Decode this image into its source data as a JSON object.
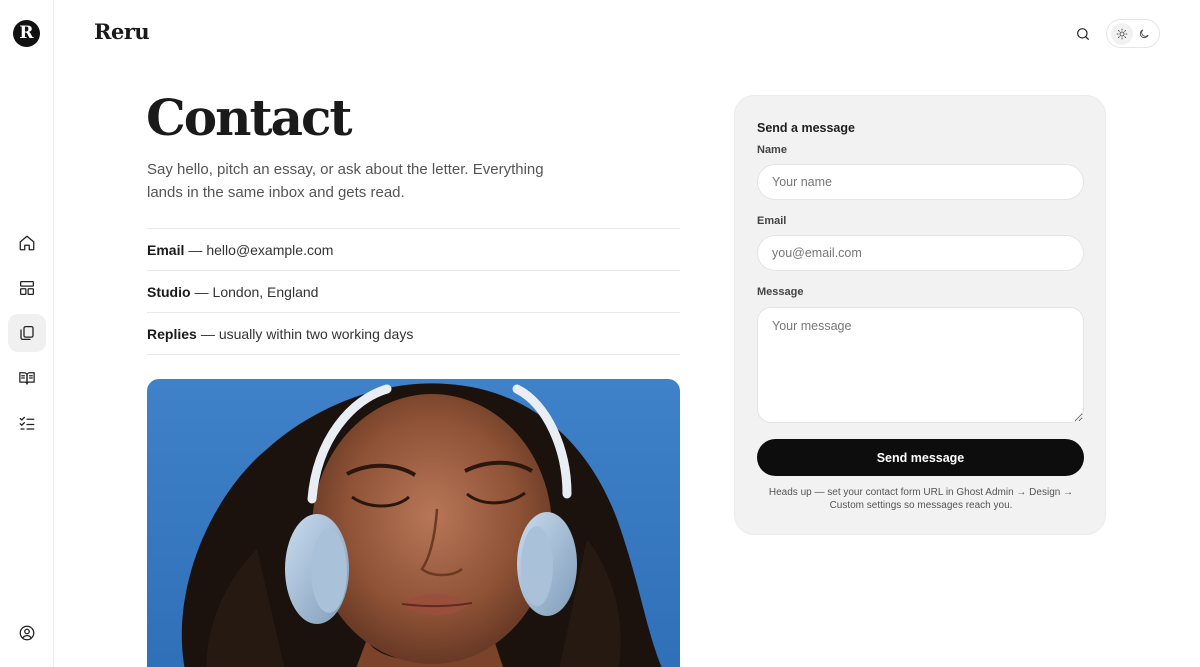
{
  "sidebar": {
    "logo_letter": "R",
    "items": [
      {
        "name": "home",
        "icon": "home-icon"
      },
      {
        "name": "layout",
        "icon": "layout-icon"
      },
      {
        "name": "pages",
        "icon": "copy-icon",
        "active": true
      },
      {
        "name": "library",
        "icon": "book-open-icon"
      },
      {
        "name": "checklist",
        "icon": "list-checks-icon"
      },
      {
        "name": "account",
        "icon": "user-circle-icon"
      }
    ]
  },
  "header": {
    "brand": "Reru",
    "search_icon": "search-icon",
    "theme_toggle": {
      "light_icon": "sun-icon",
      "dark_icon": "moon-icon",
      "selected": "light"
    }
  },
  "main": {
    "title": "Contact",
    "intro": "Say hello, pitch an essay, or ask about the letter. Everything lands in the same inbox and gets read.",
    "info": [
      {
        "label": "Email",
        "value": "hello@example.com"
      },
      {
        "label": "Studio",
        "value": "London, England"
      },
      {
        "label": "Replies",
        "value": "usually within two working days"
      }
    ],
    "sep": "—"
  },
  "form": {
    "title": "Send a message",
    "name_label": "Name",
    "name_placeholder": "Your name",
    "email_label": "Email",
    "email_placeholder": "you@email.com",
    "message_label": "Message",
    "message_placeholder": "Your message",
    "submit_label": "Send message",
    "note": "Heads up — set your contact form URL in Ghost Admin → Design → Custom settings so messages reach you."
  },
  "colors": {
    "accent": "#0d0d0d",
    "card_bg": "#f2f2f2",
    "photo_sky": "#3d7fc6"
  }
}
